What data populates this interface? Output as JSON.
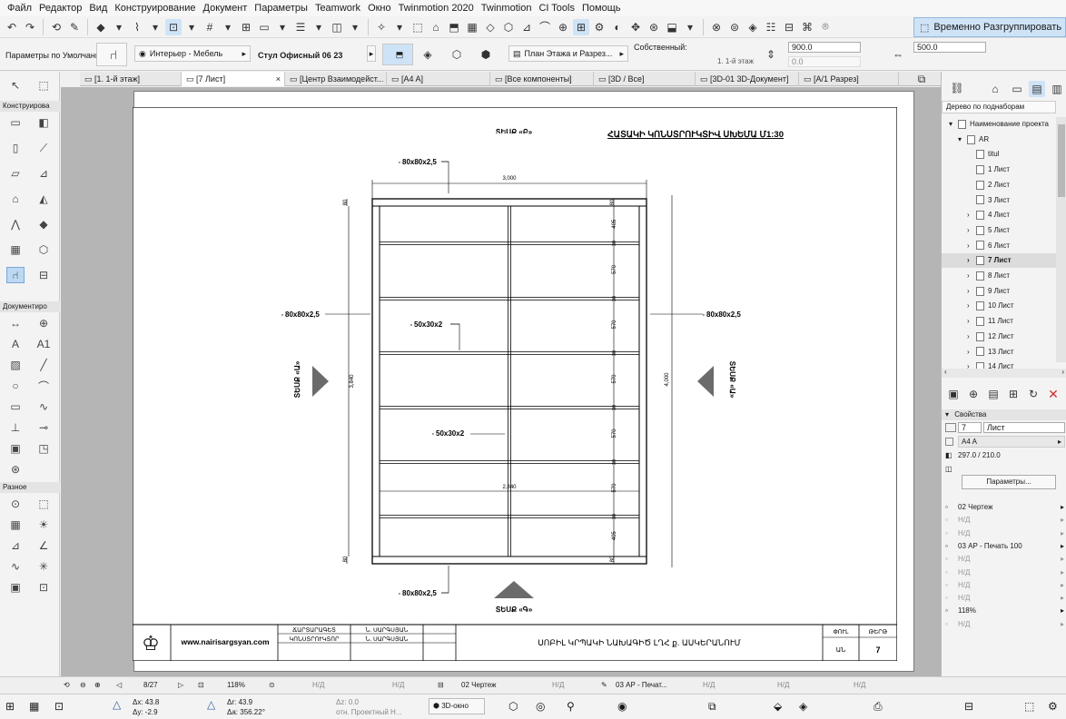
{
  "menu": [
    "Файл",
    "Редактор",
    "Вид",
    "Конструирование",
    "Документ",
    "Параметры",
    "Teamwork",
    "Окно",
    "Twinmotion 2020",
    "Twinmotion",
    "CI Tools",
    "Помощь"
  ],
  "toolbar": {
    "regroup_label": "Временно Разгруппировать"
  },
  "infobox": {
    "default_params": "Параметры по Умолчанию",
    "layer": "Интерьер - Мебель",
    "object_name": "Стул Офисный 06 23",
    "view_label": "План Этажа и Разрез...",
    "own_label": "Собственный:",
    "floor_label": "1. 1-й этаж",
    "field1_value": "900.0",
    "field2_value": "0.0",
    "field3_value": "500.0"
  },
  "tabs": [
    {
      "label": "[1. 1-й этаж]"
    },
    {
      "label": "[7 Лист]",
      "close": "×"
    },
    {
      "label": "[Центр Взаимодейст..."
    },
    {
      "label": "[A4 A]"
    },
    {
      "label": "[Все компоненты]"
    },
    {
      "label": "[3D / Все]"
    },
    {
      "label": "[3D-01 3D-Документ]"
    },
    {
      "label": "[A/1 Разрез]"
    }
  ],
  "tool_sections": {
    "construct": "Конструирова",
    "document": "Документиро",
    "misc": "Разное"
  },
  "tool_text": {
    "label_a1": "A1"
  },
  "drawing": {
    "title": "ՀԱՏԱԿԻ ԿՈՆՍՏՐՈՒԿՏԻՎ ՍԽԵՄԱ Մ1:30",
    "view_top": "ՏԵՍՔ «Բ»",
    "view_bottom": "ՏԵՍՔ «Գ»",
    "view_left": "ՏԵՍՔ «Ա»",
    "view_right": "ՏԵՍՔ «Ա»",
    "profile_main": "80x80x2,5",
    "profile_sec": "50x30x2",
    "square_mark": "▫",
    "dim_width": "3,000",
    "dim_inner": "2,840",
    "dim_height_left": "3,840",
    "dim_height_right": "4,000",
    "dim_end": "80",
    "dim_beam": "30",
    "dim_segments": [
      "405",
      "570",
      "570",
      "570",
      "570",
      "570",
      "405"
    ]
  },
  "titleblock": {
    "site": "www.nairisargsyan.com",
    "role1": "ՃԱՐՏԱՐԱԳԵՏ",
    "role2": "ԿՈՆՍՏՐՈՒԿՏՈՐ",
    "name1": "Ն. ՍԱՐԳՍՅԱՆ",
    "name2": "Ն. ՍԱՐԳՍՅԱՆ",
    "project": "ՍՈԲԻԼ ԿՐՊԱԿԻ ՆԱԽԱԳԻԾ ԼՂՀ ք. ԱՍԿԵՐԱՆՈՒՄ",
    "phase_label": "ՓՈՒԼ",
    "phase_value": "ԱՆ",
    "sheet_label": "ԹԵՐԹ",
    "sheet_value": "7"
  },
  "right_panel": {
    "tree_dropdown": "Дерево по поднаборам",
    "tree": [
      {
        "label": "Наименование проекта",
        "depth": 0,
        "expand": "▾"
      },
      {
        "label": "AR",
        "depth": 1,
        "expand": "▾"
      },
      {
        "label": "titul",
        "depth": 2,
        "expand": ""
      },
      {
        "label": "1 Лист",
        "depth": 2,
        "expand": ""
      },
      {
        "label": "2 Лист",
        "depth": 2,
        "expand": ""
      },
      {
        "label": "3 Лист",
        "depth": 2,
        "expand": ""
      },
      {
        "label": "4 Лист",
        "depth": 2,
        "expand": "›"
      },
      {
        "label": "5 Лист",
        "depth": 2,
        "expand": "›"
      },
      {
        "label": "6 Лист",
        "depth": 2,
        "expand": "›"
      },
      {
        "label": "7 Лист",
        "depth": 2,
        "expand": "›",
        "selected": true
      },
      {
        "label": "8 Лист",
        "depth": 2,
        "expand": "›"
      },
      {
        "label": "9 Лист",
        "depth": 2,
        "expand": "›"
      },
      {
        "label": "10 Лист",
        "depth": 2,
        "expand": "›"
      },
      {
        "label": "11 Лист",
        "depth": 2,
        "expand": "›"
      },
      {
        "label": "12 Лист",
        "depth": 2,
        "expand": "›"
      },
      {
        "label": "13 Лист",
        "depth": 2,
        "expand": "›"
      },
      {
        "label": "14 Лист",
        "depth": 2,
        "expand": "›"
      }
    ],
    "props_header": "Свойства",
    "id_value": "7",
    "name_value": "Лист",
    "format": "A4 A",
    "size": "297.0 / 210.0",
    "params_button": "Параметры...",
    "rows": [
      {
        "label": "02 Чертеж",
        "dim": false
      },
      {
        "label": "Н/Д",
        "dim": true
      },
      {
        "label": "Н/Д",
        "dim": true
      },
      {
        "label": "03 АР - Печать 100",
        "dim": false
      },
      {
        "label": "Н/Д",
        "dim": true
      },
      {
        "label": "Н/Д",
        "dim": true
      },
      {
        "label": "Н/Д",
        "dim": true
      },
      {
        "label": "Н/Д",
        "dim": true
      },
      {
        "label": "118%",
        "dim": false
      },
      {
        "label": "Н/Д",
        "dim": true
      }
    ]
  },
  "statusbar": {
    "page": "8/27",
    "zoom": "118%",
    "nd": "Н/Д",
    "layer_set": "02 Чертеж",
    "pen_set": "03 АР - Печат...",
    "window3d": "3D-окно"
  },
  "coords": {
    "dx": "Δx: 43.8",
    "dy": "Δy: -2.9",
    "dr": "Δr: 43.9",
    "da": "Δa: 356.22°",
    "dz": "Δz: 0.0",
    "ref": "отн. Проектный Н..."
  }
}
